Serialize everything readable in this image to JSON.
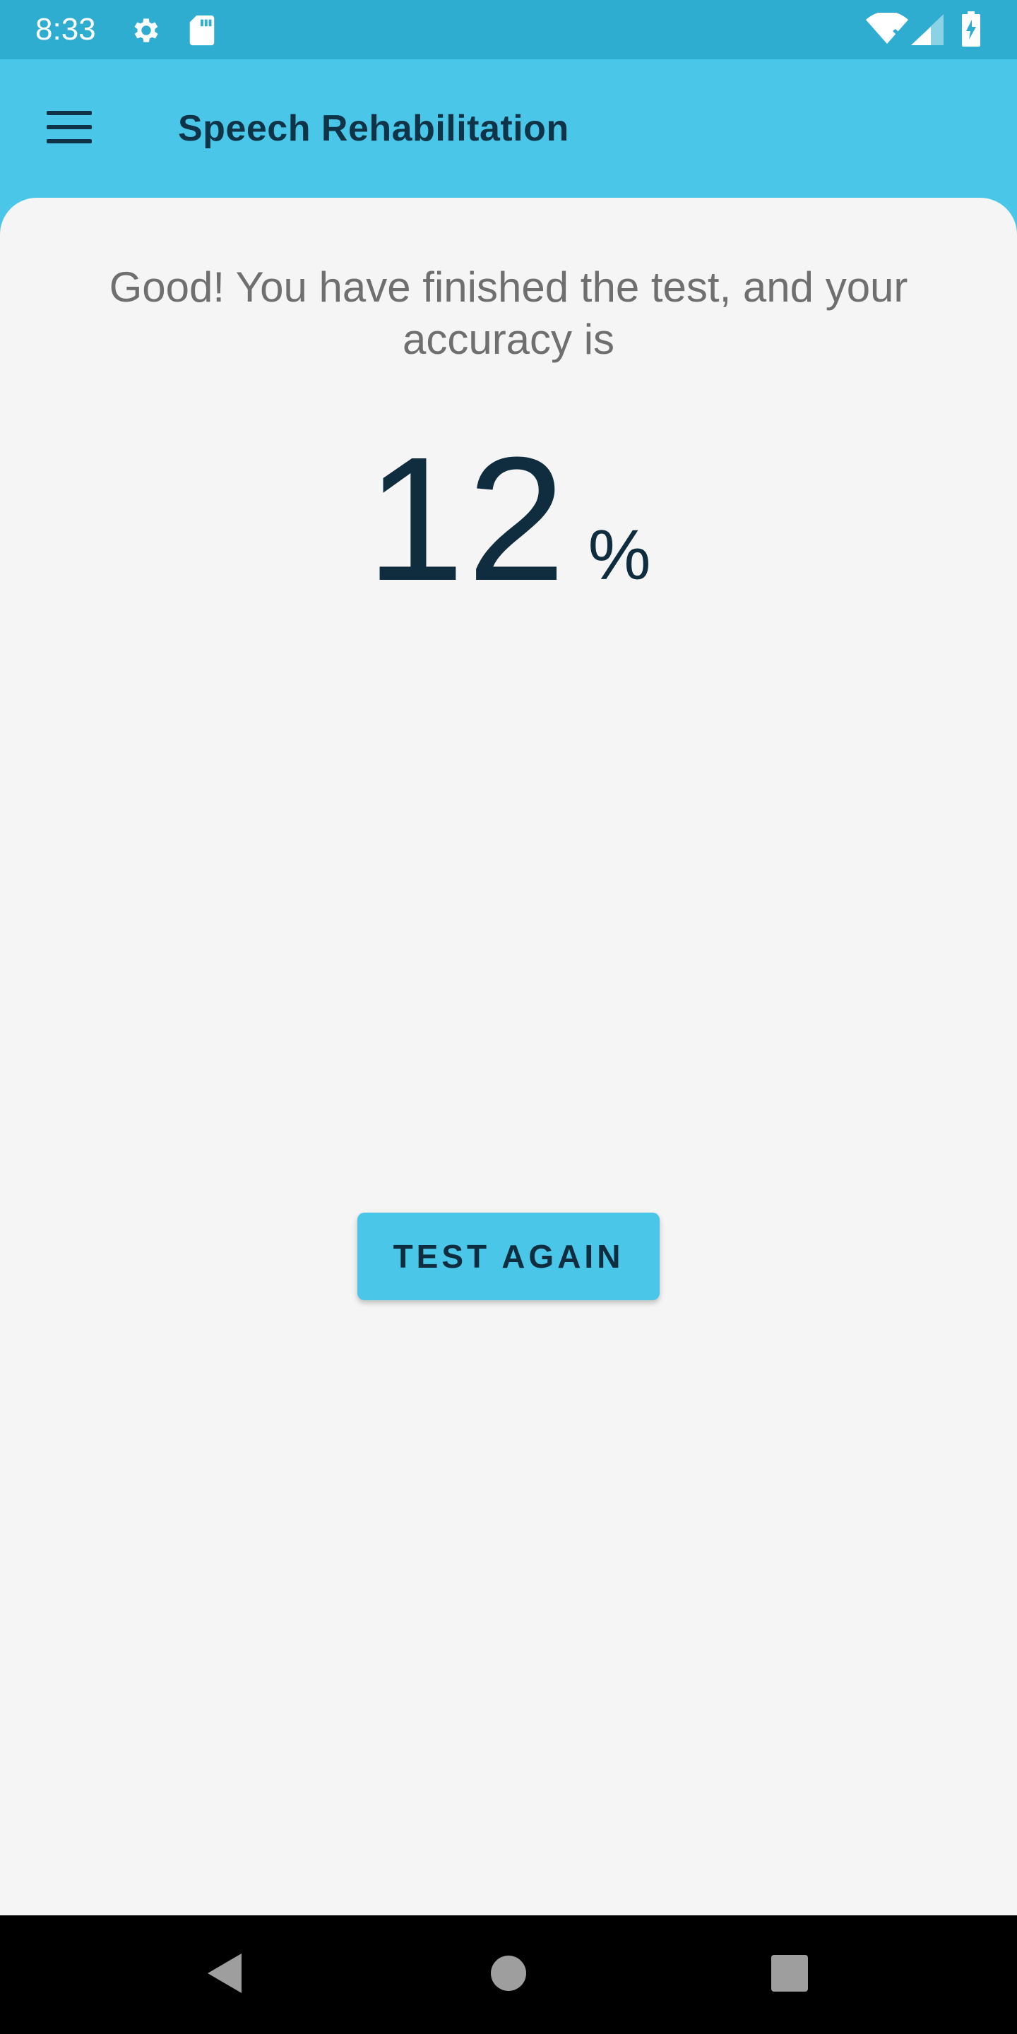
{
  "status_bar": {
    "time": "8:33",
    "icons": [
      "settings-icon",
      "sd-card-icon",
      "wifi-icon",
      "signal-icon",
      "battery-charging-icon"
    ]
  },
  "app_bar": {
    "title": "Speech Rehabilitation",
    "menu_icon": "hamburger-menu-icon"
  },
  "result": {
    "message": "Good! You have finished the test, and your accuracy is",
    "accuracy_value": "12",
    "accuracy_unit": "%"
  },
  "actions": {
    "test_again_label": "TEST AGAIN"
  },
  "nav_bar": {
    "icons": [
      "back-icon",
      "home-icon",
      "recents-icon"
    ]
  },
  "colors": {
    "primary": "#4ac7e8",
    "status_bar": "#2fadd0",
    "background": "#f5f5f5",
    "text_dark": "#0f2d3e",
    "text_muted": "#6f6f6f"
  }
}
